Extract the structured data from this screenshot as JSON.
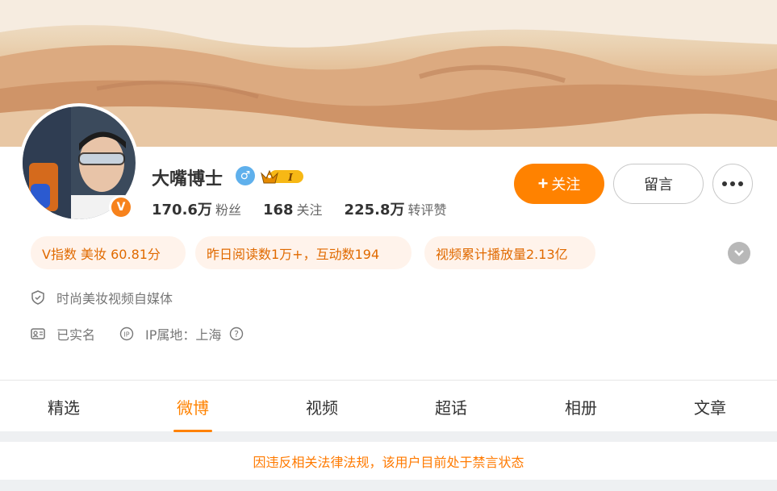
{
  "profile": {
    "name": "大嘴博士",
    "verified_badge": "V",
    "gender_symbol": "♂",
    "level_badge": "I",
    "stats": [
      {
        "num": "170.6万",
        "label": "粉丝"
      },
      {
        "num": "168",
        "label": "关注"
      },
      {
        "num": "225.8万",
        "label": "转评赞"
      }
    ]
  },
  "actions": {
    "follow_label": "关注",
    "follow_plus": "+",
    "message_label": "留言"
  },
  "highlights": [
    "V指数 美妆 60.81分",
    "昨日阅读数1万+，互动数194",
    "视频累计播放量2.13亿"
  ],
  "info": {
    "description": "时尚美妆视频自媒体",
    "real_name": "已实名",
    "ip_location": "IP属地：上海"
  },
  "tabs": [
    "精选",
    "微博",
    "视频",
    "超话",
    "相册",
    "文章"
  ],
  "active_tab_index": 1,
  "notice": "因违反相关法律法规，该用户目前处于禁言状态",
  "colors": {
    "accent": "#ff8200",
    "pill_bg": "#fff3eb",
    "pill_text": "#e06a00",
    "gender": "#5fb0ec"
  },
  "icons": [
    "shield-icon",
    "id-card-icon",
    "ip-icon",
    "help-icon",
    "chevron-down-icon",
    "more-icon",
    "crown-icon"
  ]
}
